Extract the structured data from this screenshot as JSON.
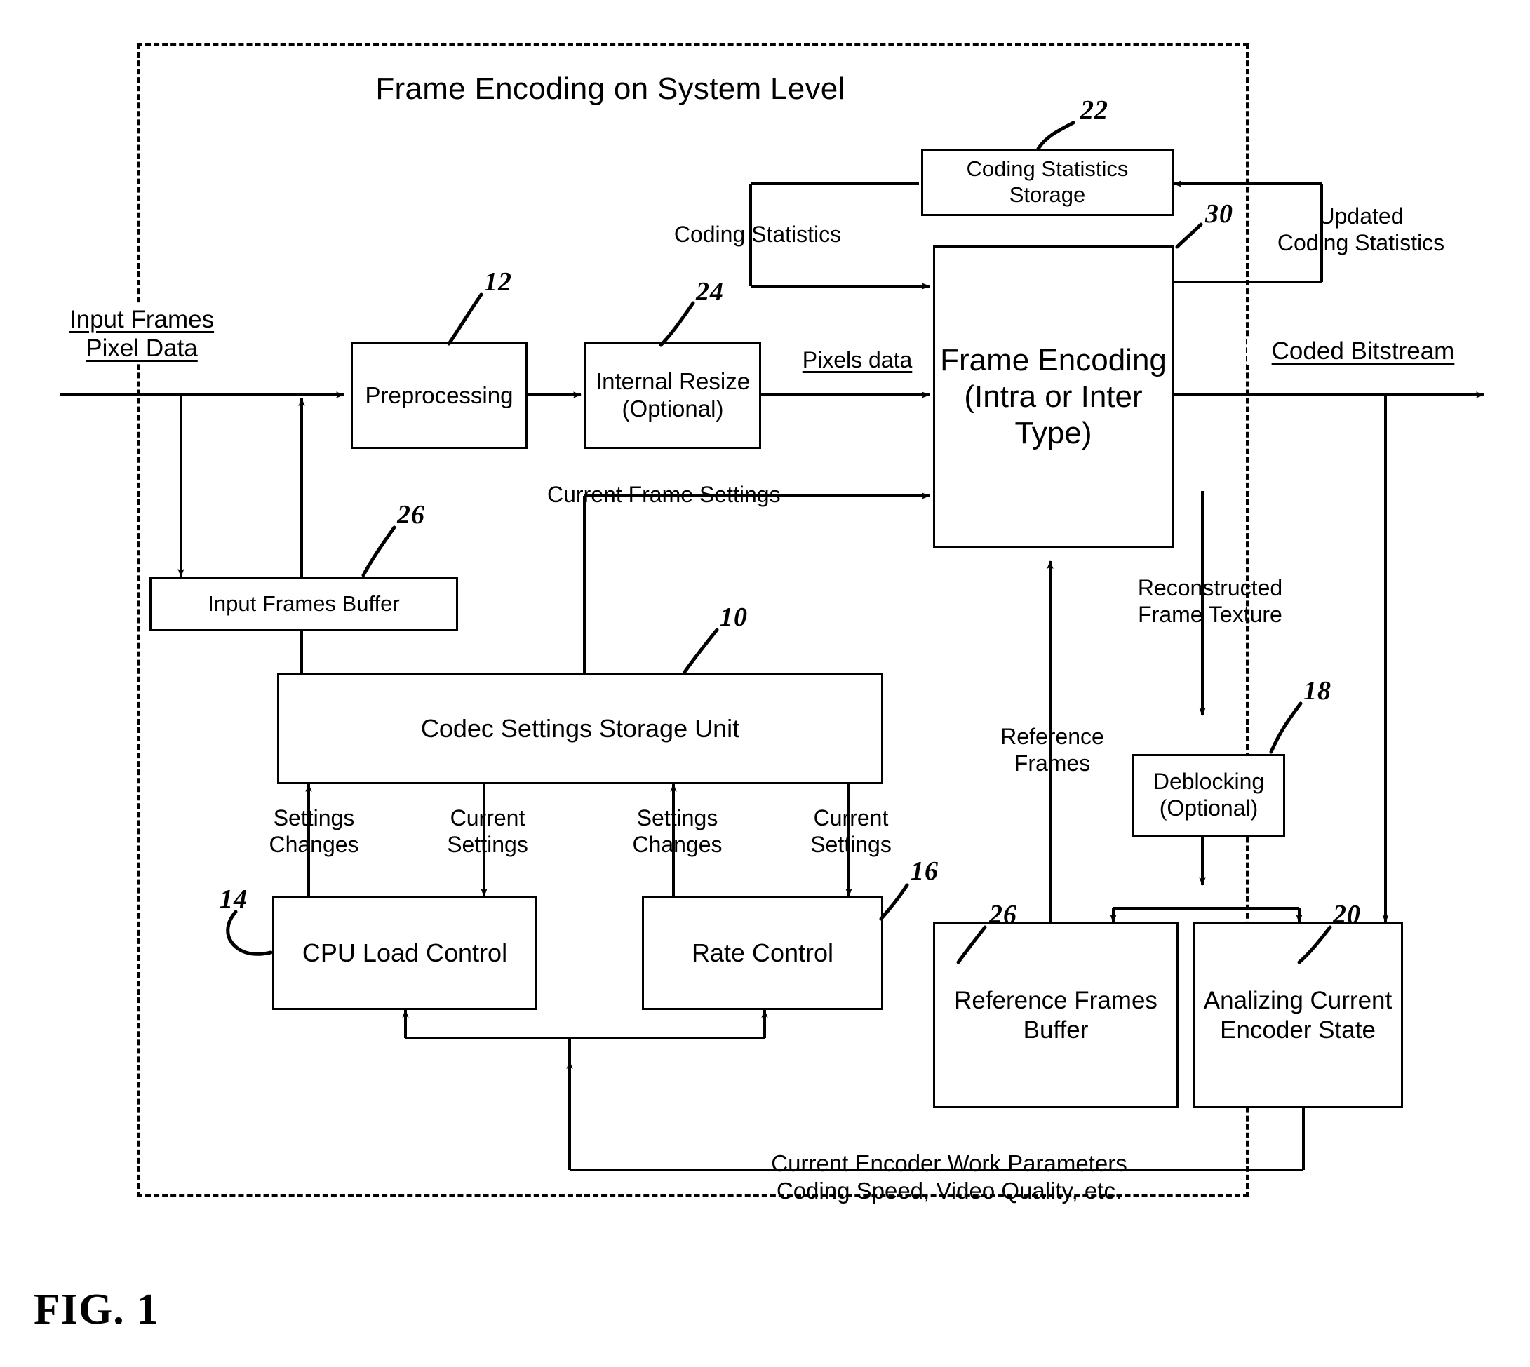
{
  "figure": {
    "title": "Frame Encoding on System Level",
    "fig_label": "FIG. 1"
  },
  "boxes": [
    {
      "id": "coding_statistics_storage",
      "label": "Coding Statistics\nStorage",
      "ref": "22"
    },
    {
      "id": "preprocessing",
      "label": "Preprocessing",
      "ref": "12"
    },
    {
      "id": "internal_resize",
      "label": "Internal Resize\n(Optional)",
      "ref": "24"
    },
    {
      "id": "frame_encoding",
      "label": "Frame\nEncoding\n(Intra or Inter\nType)",
      "ref": "30"
    },
    {
      "id": "input_frames_buffer",
      "label": "Input Frames Buffer",
      "ref": "26"
    },
    {
      "id": "codec_settings_storage_unit",
      "label": "Codec Settings Storage Unit",
      "ref": "10"
    },
    {
      "id": "cpu_load_control",
      "label": "CPU Load Control",
      "ref": "14"
    },
    {
      "id": "rate_control",
      "label": "Rate Control",
      "ref": "16"
    },
    {
      "id": "deblocking",
      "label": "Deblocking\n(Optional)",
      "ref": "18"
    },
    {
      "id": "reference_frames_buffer",
      "label": "Reference\nFrames Buffer",
      "ref": "26"
    },
    {
      "id": "analizing_current_encoder_state",
      "label": "Analizing Current\nEncoder State",
      "ref": "20"
    }
  ],
  "signals": {
    "input_frames_pixel_data": "Input Frames\nPixel Data",
    "coded_bitstream": "Coded Bitstream",
    "coding_statistics": "Coding Statistics",
    "updated_coding_statistics": "Updated\nCoding Statistics",
    "pixels_data": "Pixels data",
    "current_frame_settings": "Current Frame Settings",
    "reconstructed_frame_texture": "Reconstructed\nFrame Texture",
    "reference_frames": "Reference\nFrames",
    "settings_changes_1": "Settings\nChanges",
    "current_settings_1": "Current\nSettings",
    "settings_changes_2": "Settings\nChanges",
    "current_settings_2": "Current\nSettings",
    "encoder_work_parameters": "Current Encoder Work Parameters\nCoding Speed, Video Quality, etc."
  },
  "refnums": {
    "n22": "22",
    "n30": "30",
    "n12": "12",
    "n24": "24",
    "n26a": "26",
    "n10": "10",
    "n18": "18",
    "n14": "14",
    "n16": "16",
    "n26b": "26",
    "n20": "20"
  },
  "style": {
    "line_color": "#000000",
    "background": "#ffffff"
  }
}
